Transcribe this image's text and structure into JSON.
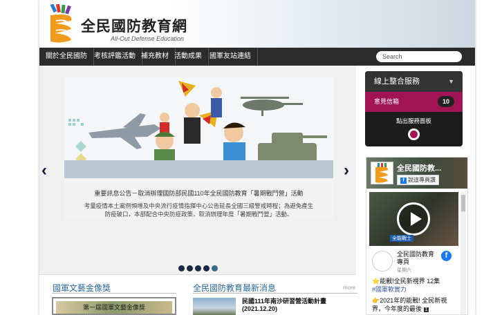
{
  "site": {
    "logo_title": "全民國防教育網",
    "logo_subtitle": "All-Out Defense Education"
  },
  "nav": {
    "items": [
      {
        "label": "關於全民國防"
      },
      {
        "label": "考核評鑑活動"
      },
      {
        "label": "補充教材"
      },
      {
        "label": "活動成果"
      },
      {
        "label": "國軍友站連結"
      }
    ],
    "search_placeholder": "Search"
  },
  "slider": {
    "caption_title": "重要訊息公告－取消辦理國防部民國110年全民國防教育「暑期戰鬥營」活動",
    "caption_body": "考量疫情本土案例頻增及中央流行疫情指揮中心公告延長全國三級警戒時程；為避免產生防疫破口，本部配合中央防疫政策，取消辦理年度「暑期戰鬥營」活動。",
    "prev_icon": "chevron-left-icon",
    "next_icon": "chevron-right-icon",
    "dot_count": 5,
    "active_dot": 5
  },
  "service": {
    "title": "線上整合服務",
    "mailbox_label": "意見信箱",
    "mailbox_count": "10",
    "toggle_label": "點出服務面板"
  },
  "facebook": {
    "page_name": "全民國防教...",
    "like_label": "說這專頁讚",
    "video_caption": "全能戰士",
    "post_author": "全民國防教育專頁",
    "post_time": "星期六",
    "post_text_1": "⭐能戰!全民新視界 12集",
    "post_hashtag": "#國軍軟實力",
    "post_text_2": "👉2021年的能戰! 全民新視界，今年度的最後",
    "post_badge": "1"
  },
  "sections": {
    "art_title": "國軍文藝金像獎",
    "art_banner": "第一屆國軍文藝金像獎",
    "news_title": "全民國防教育最新消息",
    "more_label": "more",
    "news_item_title": "民國111年南沙研習營活動計畫",
    "news_item_date": "(2021.12.20)"
  }
}
